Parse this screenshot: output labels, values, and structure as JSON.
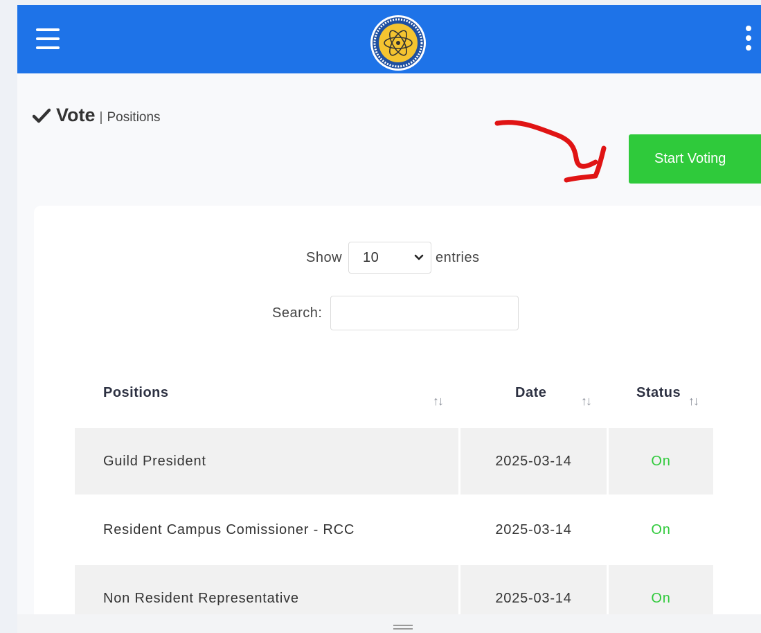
{
  "header": {
    "menu_icon": "hamburger-icon",
    "logo_icon": "atom-logo-icon",
    "more_icon": "kebab-menu-icon",
    "bar_color": "#1e73e8"
  },
  "page": {
    "title": "Vote",
    "separator": "|",
    "subtitle": "Positions",
    "title_icon": "checkmark-icon"
  },
  "actions": {
    "start_voting_label": "Start Voting",
    "button_color": "#2fca3b",
    "annotation": "red-arrow-pointing-to-button"
  },
  "table_controls": {
    "show_label": "Show",
    "entries_value": "10",
    "entries_label": "entries",
    "search_label": "Search:",
    "search_value": "",
    "search_placeholder": ""
  },
  "table": {
    "columns": [
      "Positions",
      "Date",
      "Status"
    ],
    "sort_icon": "sort-arrows-icon",
    "rows": [
      {
        "position": "Guild President",
        "date": "2025-03-14",
        "status": "On"
      },
      {
        "position": "Resident Campus Comissioner - RCC",
        "date": "2025-03-14",
        "status": "On"
      },
      {
        "position": "Non Resident Representative",
        "date": "2025-03-14",
        "status": "On"
      }
    ],
    "status_color": "#2fca3b"
  }
}
